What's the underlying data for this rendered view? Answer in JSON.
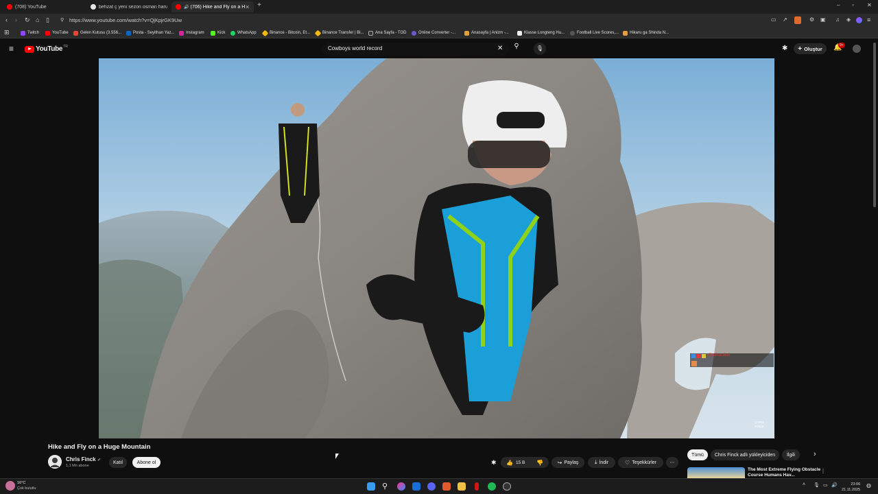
{
  "tabs": [
    {
      "label": "(708) YouTube"
    },
    {
      "label": "behzat ç yeni sezon osman harun - G"
    },
    {
      "label": "(706) Hike and Fly on a Huge"
    }
  ],
  "browser": {
    "url": "https://www.youtube.com/watch?v=QjKpjrGK9Uw"
  },
  "bookmarks": [
    {
      "label": "Twitch"
    },
    {
      "label": "YouTube"
    },
    {
      "label": "Gelen Kutusu (3.556..."
    },
    {
      "label": "Posta - Seyithan Yaz..."
    },
    {
      "label": "Instagram"
    },
    {
      "label": "Kick"
    },
    {
      "label": "WhatsApp"
    },
    {
      "label": "Binance - Bitcoin, Et..."
    },
    {
      "label": "Binance Transfer | Bi..."
    },
    {
      "label": "Ana Sayfa - TOD"
    },
    {
      "label": "Online Converter -..."
    },
    {
      "label": "Anasayfa | Anizm -..."
    },
    {
      "label": "Klasse Longteng Hu..."
    },
    {
      "label": "Football Live Scores,..."
    },
    {
      "label": "Hikaru ga Shinda N..."
    }
  ],
  "youtube": {
    "logo_text": "YouTube",
    "country_code": "TR",
    "search_query": "Cowboys world record",
    "create_label": "Oluştur",
    "notif_count": "9+"
  },
  "video": {
    "title": "Hike and Fly on a Huge Mountain",
    "channel": "Chris Finck",
    "subscribers": "1,1 Mn abone",
    "watermark": "CHRIS FINCK",
    "overlay_name": "@ntiharakel"
  },
  "actions": {
    "join": "Katıl",
    "subscribe": "Abone ol",
    "likes": "15 B",
    "share": "Paylaş",
    "download": "İndir",
    "thanks": "Teşekkürler"
  },
  "chips": [
    "Tümü",
    "Chris Finck adlı yükleyiciden",
    "İlgili"
  ],
  "recommendation": {
    "title": "The Most Extreme Flying Obstacle Course Humans Hav..."
  },
  "taskbar": {
    "temp": "16°C",
    "weather": "Çok bulutlu",
    "time": "23:06",
    "date": "21.11.2025"
  }
}
